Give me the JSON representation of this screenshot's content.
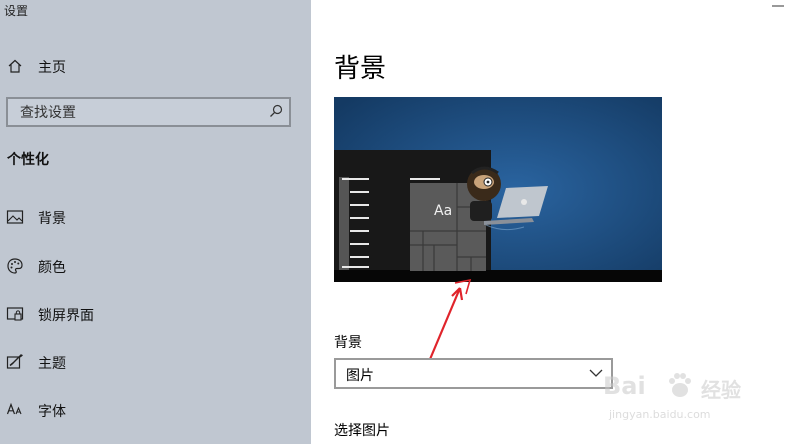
{
  "app": {
    "title": "设置"
  },
  "sidebar": {
    "home_label": "主页",
    "search": {
      "placeholder": "查找设置",
      "icon": "search-icon"
    },
    "section_title": "个性化",
    "items": [
      {
        "label": "背景",
        "icon": "picture-icon"
      },
      {
        "label": "颜色",
        "icon": "palette-icon"
      },
      {
        "label": "锁屏界面",
        "icon": "lock-screen-icon"
      },
      {
        "label": "主题",
        "icon": "theme-icon"
      },
      {
        "label": "字体",
        "icon": "font-icon"
      }
    ]
  },
  "main": {
    "page_title": "背景",
    "preview": {
      "sample_text": "Aa"
    },
    "background_label": "背景",
    "background_select": {
      "value": "图片"
    },
    "choose_picture_label": "选择图片"
  },
  "watermark": {
    "logo": "Bai",
    "cn": "经验",
    "url": "jingyan.baidu.com"
  },
  "colors": {
    "sidebar_bg": "#c0c7d1",
    "preview_bg": "#1b4a78",
    "annotation_arrow": "#e0242b"
  }
}
